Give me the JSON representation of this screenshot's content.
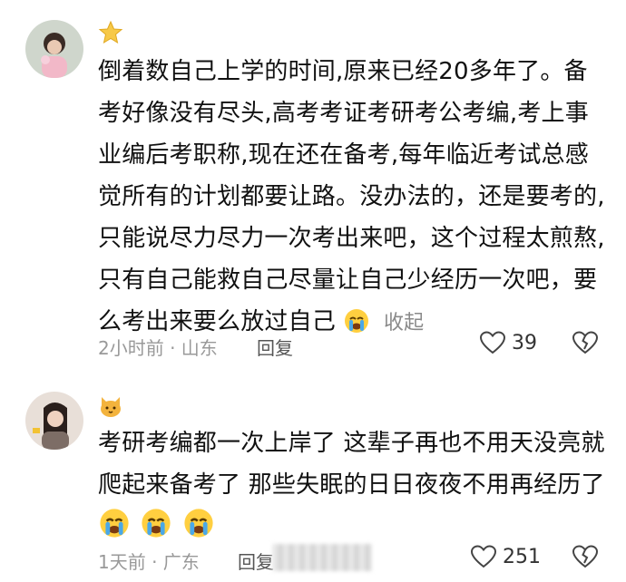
{
  "comments": [
    {
      "nickname_badge": "star-emoji-icon",
      "lines": [
        "倒着数自己上学的时间,原来已经20多年了。备",
        "考好像没有尽头,高考考证考研考公考编,考上事",
        "业编后考职称,现在还在备考,每年临近考试总感",
        "觉所有的计划都要让路。没办法的，还是要考的,",
        "只能说尽力尽力一次考出来吧，这个过程太煎熬,",
        "只有自己能救自己尽量让自己少经历一次吧，要",
        "么考出来要么放过自己"
      ],
      "trailing_emoji": "crying-emoji-icon",
      "collapse_label": "收起",
      "meta": "2小时前 · 山东",
      "reply_label": "回复",
      "likes": "39"
    },
    {
      "nickname_badge": "cat-emoji-icon",
      "lines": [
        "考研考编都一次上岸了 这辈子再也不用天没亮就",
        "爬起来备考了 那些失眠的日日夜夜不用再经历了"
      ],
      "trailing_emojis": [
        "crying-emoji-icon",
        "crying-emoji-icon",
        "crying-emoji-icon"
      ],
      "meta": "1天前 · 广东",
      "reply_label": "回复",
      "likes": "251"
    }
  ]
}
